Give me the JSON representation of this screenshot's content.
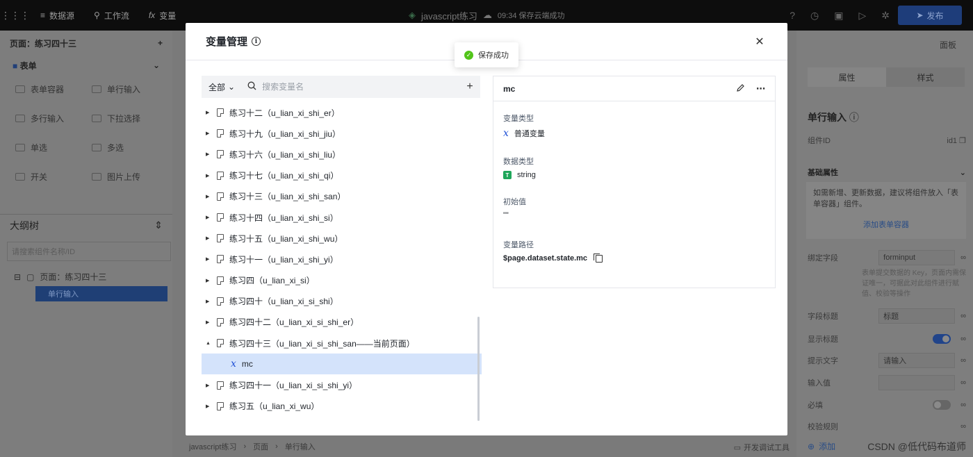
{
  "topbar": {
    "nav": [
      {
        "icon": "database-icon",
        "glyph": "≡",
        "label": "数据源"
      },
      {
        "icon": "workflow-icon",
        "glyph": "⚲",
        "label": "工作流"
      },
      {
        "icon": "function-icon",
        "glyph": "fx",
        "label": "变量"
      }
    ],
    "app_name": "javascript练习",
    "save_status": "09:34 保存云端成功",
    "publish_label": "发布"
  },
  "left_panel": {
    "page_selector": "页面：练习四十三",
    "section": "表单",
    "components": [
      "表单容器",
      "单行输入",
      "多行输入",
      "下拉选择",
      "单选",
      "多选",
      "开关",
      "图片上传"
    ],
    "outline_title": "大纲树",
    "outline_search_placeholder": "请搜索组件名称/ID",
    "outline_page": "页面：练习四十三",
    "outline_selected": "单行输入"
  },
  "canvas_footer": {
    "breadcrumb": [
      "javascript练习",
      "页面",
      "单行输入"
    ],
    "dev_tools": "开发调试工具"
  },
  "right_panel": {
    "panel_label": "面板",
    "tabs": [
      "属性",
      "样式"
    ],
    "component_title": "单行输入",
    "component_id_label": "组件ID",
    "component_id_value": "id1",
    "basic_props": "基础属性",
    "hint": "如需新增、更新数据，建议将组件放入「表单容器」组件。",
    "hint_link": "添加表单容器",
    "bind_field_label": "绑定字段",
    "bind_field_value": "forminput",
    "bind_desc": "表单提交数据的 Key，页面内需保证唯一，可据此对此组件进行赋值、校验等操作",
    "field_title_label": "字段标题",
    "field_title_value": "标题",
    "show_title_label": "显示标题",
    "placeholder_label": "提示文字",
    "placeholder_value": "请输入",
    "input_value_label": "输入值",
    "required_label": "必填",
    "validation_label": "校验规则",
    "add_label": "添加",
    "watermark": "CSDN @低代码布道师"
  },
  "modal": {
    "title": "变量管理",
    "scope_label": "全部",
    "search_placeholder": "搜索变量名",
    "toast": "保存成功",
    "tree": [
      {
        "label": "练习十二（u_lian_xi_shi_er）",
        "expanded": false
      },
      {
        "label": "练习十九（u_lian_xi_shi_jiu）",
        "expanded": false
      },
      {
        "label": "练习十六（u_lian_xi_shi_liu）",
        "expanded": false
      },
      {
        "label": "练习十七（u_lian_xi_shi_qi）",
        "expanded": false
      },
      {
        "label": "练习十三（u_lian_xi_shi_san）",
        "expanded": false
      },
      {
        "label": "练习十四（u_lian_xi_shi_si）",
        "expanded": false
      },
      {
        "label": "练习十五（u_lian_xi_shi_wu）",
        "expanded": false
      },
      {
        "label": "练习十一（u_lian_xi_shi_yi）",
        "expanded": false
      },
      {
        "label": "练习四（u_lian_xi_si）",
        "expanded": false
      },
      {
        "label": "练习四十（u_lian_xi_si_shi）",
        "expanded": false
      },
      {
        "label": "练习四十二（u_lian_xi_si_shi_er）",
        "expanded": false
      },
      {
        "label": "练习四十三（u_lian_xi_si_shi_san——当前页面）",
        "expanded": true,
        "children": [
          "mc"
        ]
      },
      {
        "label": "练习四十一（u_lian_xi_si_shi_yi）",
        "expanded": false
      },
      {
        "label": "练习五（u_lian_xi_wu）",
        "expanded": false
      }
    ],
    "detail": {
      "name": "mc",
      "var_type_label": "变量类型",
      "var_type_value": "普通变量",
      "data_type_label": "数据类型",
      "data_type_value": "string",
      "init_label": "初始值",
      "init_value": "\"\"",
      "path_label": "变量路径",
      "path_value": "$page.dataset.state.mc"
    }
  },
  "colors": {
    "accent": "#1f50d6",
    "selected_row": "#d4e3fb",
    "success": "#52c41a",
    "string_badge": "#1fa65a"
  }
}
